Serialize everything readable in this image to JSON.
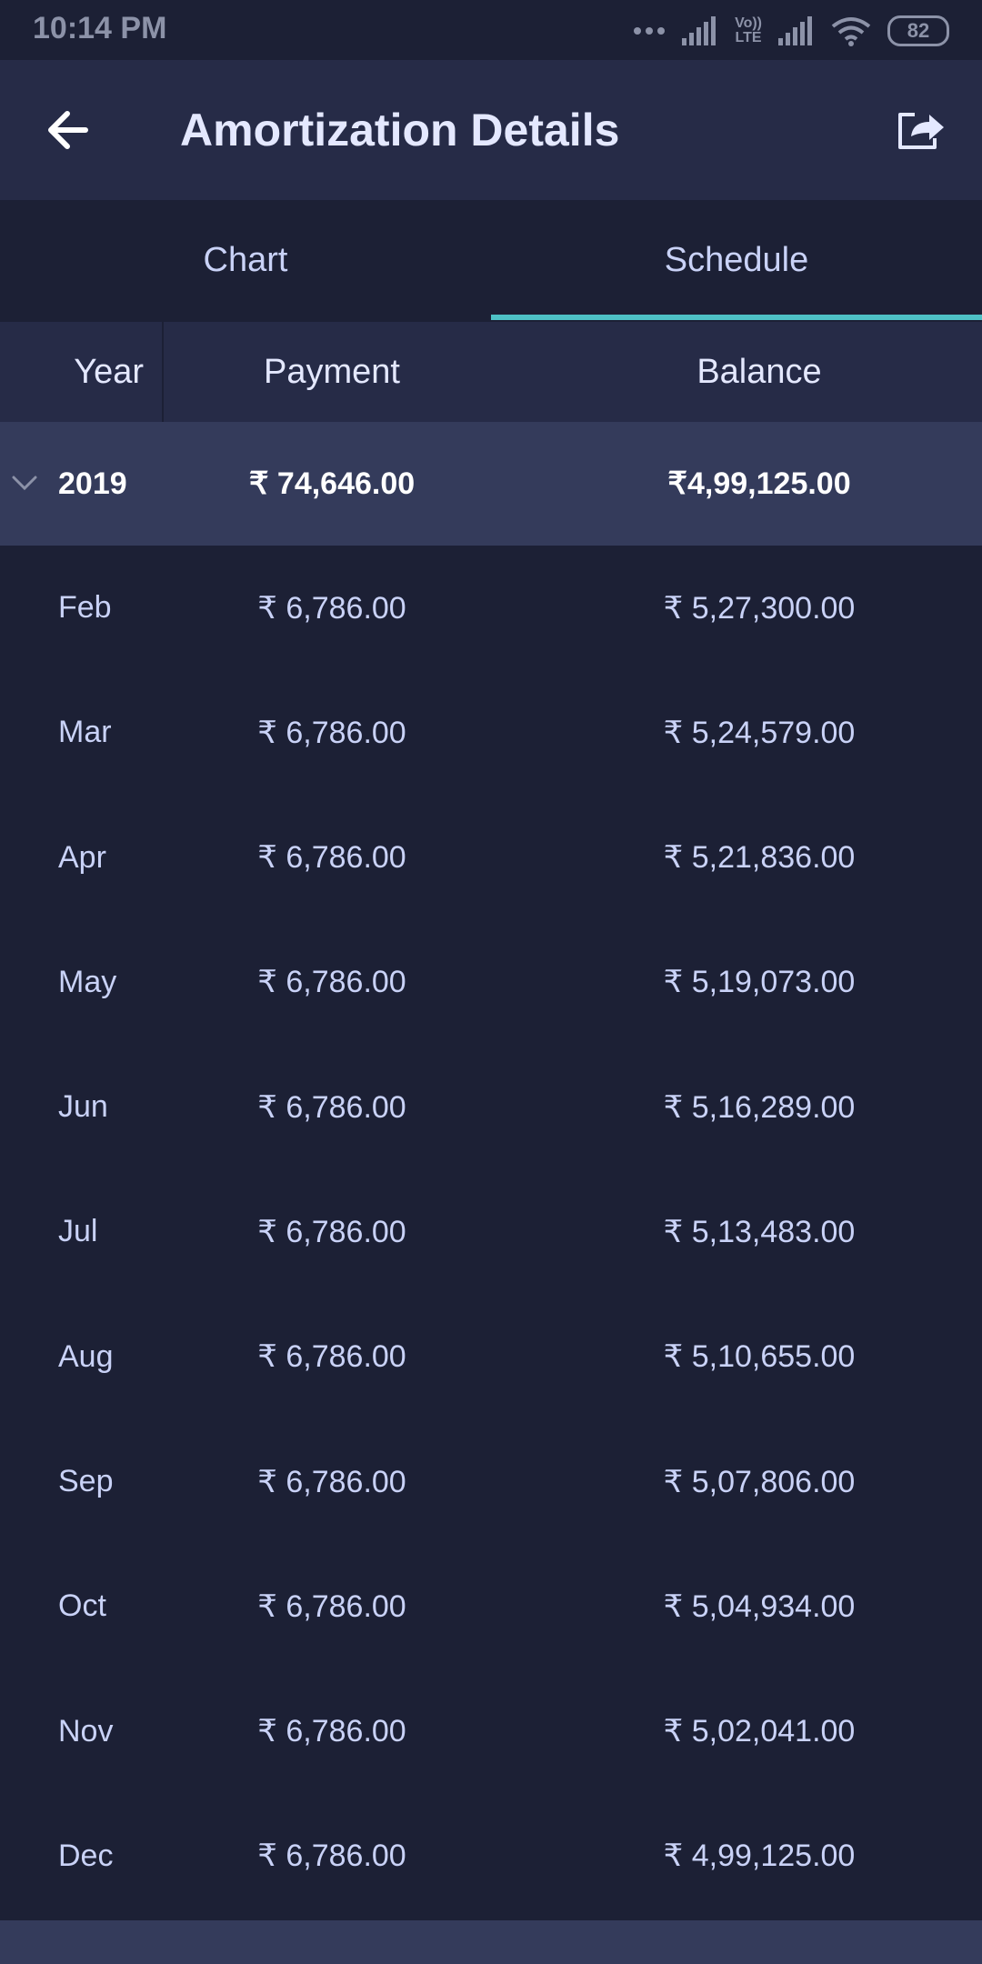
{
  "status_bar": {
    "time": "10:14 PM",
    "volte_top": "Vo))",
    "volte_bottom": "LTE",
    "battery": "82"
  },
  "app_bar": {
    "title": "Amortization Details",
    "back_icon": "arrow-left-icon",
    "share_icon": "share-icon"
  },
  "tabs": [
    {
      "label": "Chart",
      "active": false
    },
    {
      "label": "Schedule",
      "active": true
    }
  ],
  "table": {
    "headers": {
      "year": "Year",
      "payment": "Payment",
      "balance": "Balance"
    },
    "year_group": {
      "year": "2019",
      "payment": "₹ 74,646.00",
      "balance": "₹4,99,125.00",
      "expanded": true
    },
    "rows": [
      {
        "month": "Feb",
        "payment": "₹ 6,786.00",
        "balance": "₹ 5,27,300.00"
      },
      {
        "month": "Mar",
        "payment": "₹ 6,786.00",
        "balance": "₹ 5,24,579.00"
      },
      {
        "month": "Apr",
        "payment": "₹ 6,786.00",
        "balance": "₹ 5,21,836.00"
      },
      {
        "month": "May",
        "payment": "₹ 6,786.00",
        "balance": "₹ 5,19,073.00"
      },
      {
        "month": "Jun",
        "payment": "₹ 6,786.00",
        "balance": "₹ 5,16,289.00"
      },
      {
        "month": "Jul",
        "payment": "₹ 6,786.00",
        "balance": "₹ 5,13,483.00"
      },
      {
        "month": "Aug",
        "payment": "₹ 6,786.00",
        "balance": "₹ 5,10,655.00"
      },
      {
        "month": "Sep",
        "payment": "₹ 6,786.00",
        "balance": "₹ 5,07,806.00"
      },
      {
        "month": "Oct",
        "payment": "₹ 6,786.00",
        "balance": "₹ 5,04,934.00"
      },
      {
        "month": "Nov",
        "payment": "₹ 6,786.00",
        "balance": "₹ 5,02,041.00"
      },
      {
        "month": "Dec",
        "payment": "₹ 6,786.00",
        "balance": "₹ 4,99,125.00"
      }
    ]
  },
  "colors": {
    "background": "#1c2035",
    "app_bar": "#262b47",
    "year_row": "#343b5b",
    "tab_indicator": "#4ec1c6",
    "text": "#c9d2f7"
  }
}
